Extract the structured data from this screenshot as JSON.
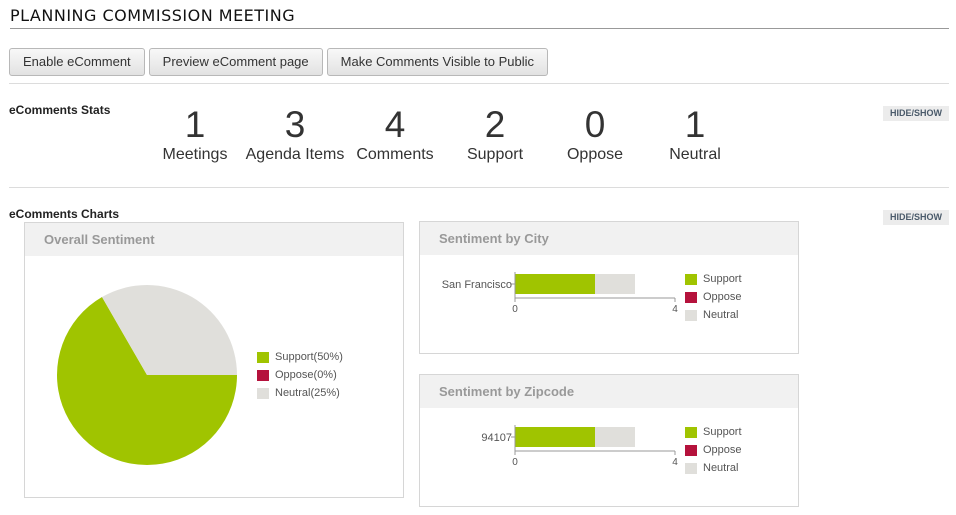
{
  "page": {
    "title": "PLANNING COMMISSION MEETING"
  },
  "toolbar": {
    "enable": "Enable eComment",
    "preview": "Preview eComment page",
    "visible": "Make Comments Visible to Public"
  },
  "stats": {
    "title": "eComments Stats",
    "toggle": "HIDE/SHOW",
    "items": [
      {
        "value": "1",
        "label": "Meetings"
      },
      {
        "value": "3",
        "label": "Agenda Items"
      },
      {
        "value": "4",
        "label": "Comments"
      },
      {
        "value": "2",
        "label": "Support"
      },
      {
        "value": "0",
        "label": "Oppose"
      },
      {
        "value": "1",
        "label": "Neutral"
      }
    ]
  },
  "charts": {
    "title": "eComments Charts",
    "toggle": "HIDE/SHOW",
    "colors": {
      "support": "#a0c400",
      "oppose": "#b5123c",
      "neutral": "#e0dfdb"
    },
    "overall": {
      "title": "Overall Sentiment",
      "legend": [
        "Support(50%)",
        "Oppose(0%)",
        "Neutral(25%)"
      ]
    },
    "city": {
      "title": "Sentiment by City",
      "legend": [
        "Support",
        "Oppose",
        "Neutral"
      ]
    },
    "zip": {
      "title": "Sentiment by Zipcode",
      "legend": [
        "Support",
        "Oppose",
        "Neutral"
      ]
    }
  },
  "chart_data": [
    {
      "type": "pie",
      "title": "Overall Sentiment",
      "categories": [
        "Support",
        "Oppose",
        "Neutral"
      ],
      "values": [
        2,
        0,
        1
      ]
    },
    {
      "type": "bar",
      "title": "Sentiment by City",
      "orientation": "horizontal",
      "stacked": true,
      "categories": [
        "San Francisco"
      ],
      "series": [
        {
          "name": "Support",
          "values": [
            2
          ]
        },
        {
          "name": "Oppose",
          "values": [
            0
          ]
        },
        {
          "name": "Neutral",
          "values": [
            1
          ]
        }
      ],
      "xlim": [
        0,
        4
      ],
      "xticks": [
        "0",
        "4"
      ]
    },
    {
      "type": "bar",
      "title": "Sentiment by Zipcode",
      "orientation": "horizontal",
      "stacked": true,
      "categories": [
        "94107"
      ],
      "series": [
        {
          "name": "Support",
          "values": [
            2
          ]
        },
        {
          "name": "Oppose",
          "values": [
            0
          ]
        },
        {
          "name": "Neutral",
          "values": [
            1
          ]
        }
      ],
      "xlim": [
        0,
        4
      ],
      "xticks": [
        "0",
        "4"
      ]
    }
  ]
}
